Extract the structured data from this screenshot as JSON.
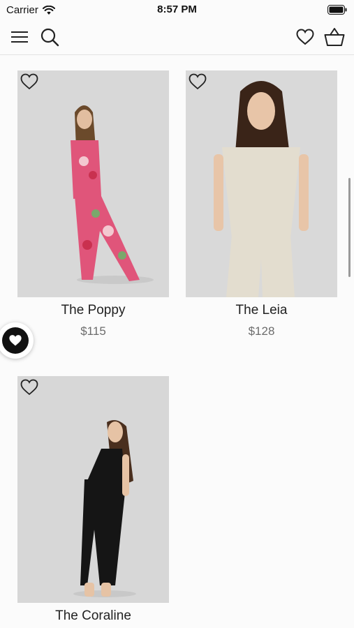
{
  "status_bar": {
    "carrier": "Carrier",
    "time": "8:57 PM"
  },
  "nav": {
    "menu_icon": "hamburger-menu-icon",
    "search_icon": "search-icon",
    "wishlist_icon": "heart-outline-icon",
    "cart_icon": "basket-icon"
  },
  "products": [
    {
      "name": "The Poppy",
      "price": "$115",
      "outfit_color": "#e0557a"
    },
    {
      "name": "The Leia",
      "price": "$128",
      "outfit_color": "#e3ddcf"
    },
    {
      "name": "The Coraline",
      "price": "",
      "outfit_color": "#151515"
    }
  ],
  "colors": {
    "accent": "#111111",
    "background": "#fbfbfb",
    "photo_bg": "#d6d6d6"
  }
}
